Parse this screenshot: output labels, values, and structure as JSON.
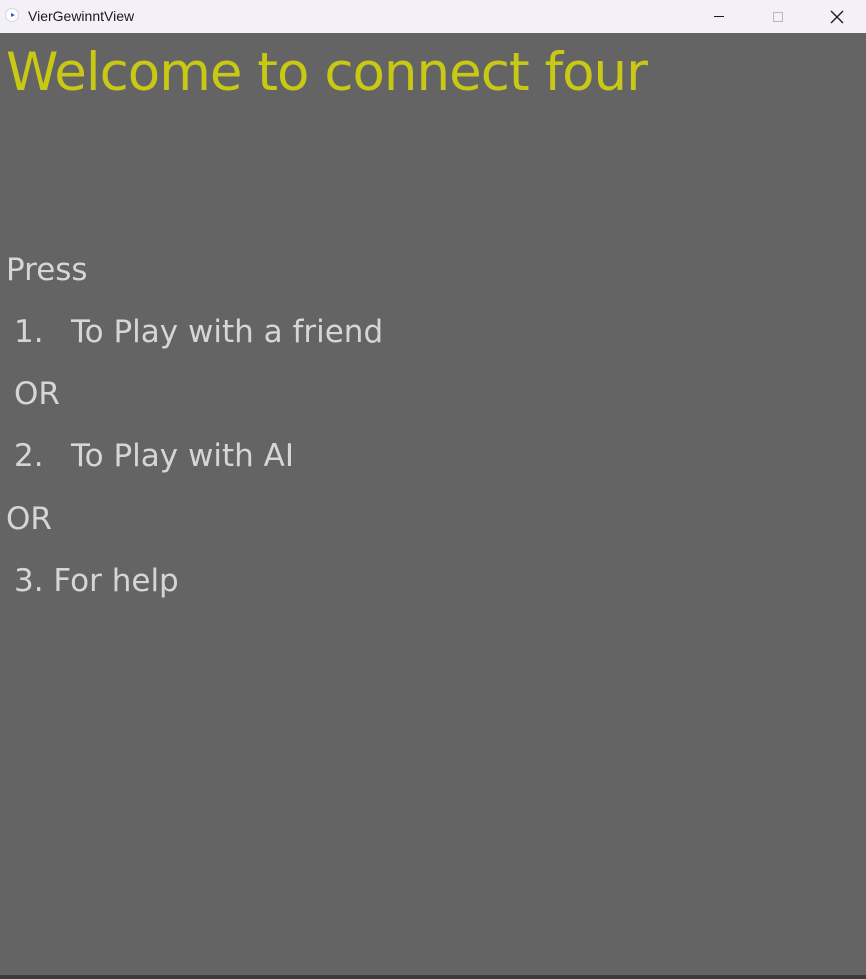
{
  "window": {
    "title": "VierGewinntView",
    "controls": {
      "minimize": "minimize",
      "maximize": "maximize",
      "close": "close"
    }
  },
  "content": {
    "heading": "Welcome to connect four",
    "press": "Press",
    "option1": {
      "number": "1.",
      "label": "To Play with a friend"
    },
    "or1": "OR",
    "option2": {
      "number": "2.",
      "label": "To Play with AI"
    },
    "or2": "OR",
    "option3": "3. For help"
  },
  "colors": {
    "background": "#646464",
    "heading": "#c8c815",
    "text": "#d6d6d6",
    "titlebar": "#f4f0f7"
  }
}
